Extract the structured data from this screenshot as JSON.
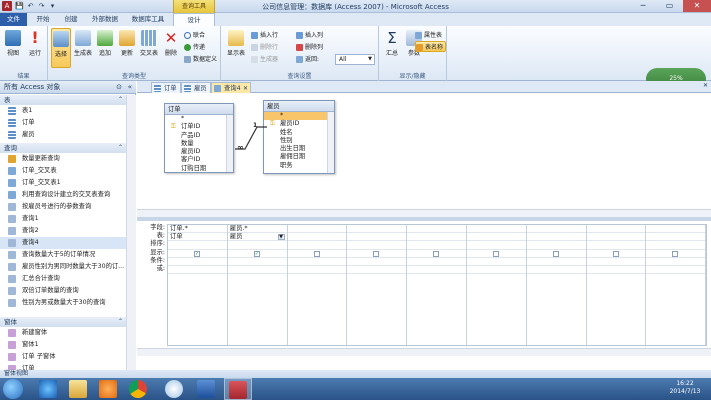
{
  "window": {
    "title": "公司信息管理：数据库 (Access 2007) - Microsoft Access",
    "context_tab": "查询工具",
    "close_glyph": "✕",
    "min_glyph": "─",
    "max_glyph": "▭"
  },
  "app_icon": {
    "letter": "A"
  },
  "qat": [
    "💾",
    "↶",
    "↷",
    "▾"
  ],
  "ribbon_tabs": [
    "文件",
    "开始",
    "创建",
    "外部数据",
    "数据库工具",
    "设计"
  ],
  "ribbon": {
    "groups": [
      "结果",
      "查询类型",
      "查询设置",
      "显示/隐藏"
    ],
    "buttons": {
      "view": "视图",
      "run": "运行",
      "select": "选择",
      "make_table": "生成表",
      "append": "追加",
      "update": "更新",
      "crosstab": "交叉表",
      "delete": "删除",
      "union": "联合",
      "pass_through": "传递",
      "data_definition": "数据定义",
      "show_table": "显示表",
      "insert_rows": "插入行",
      "delete_rows": "删除行",
      "builder": "生成器",
      "insert_columns": "插入列",
      "delete_columns": "删除列",
      "return_label": "返回:",
      "return_value": "All",
      "totals": "汇总",
      "parameters": "参数",
      "property_sheet": "属性表",
      "table_names": "表名称"
    },
    "widget_text": "25%"
  },
  "nav": {
    "header": "所有 Access 对象",
    "sections": [
      {
        "title": "表",
        "items": [
          "表1",
          "订单",
          "雇员"
        ]
      },
      {
        "title": "查询",
        "items": [
          "数量更新查询",
          "订单_交叉表",
          "订单_交叉表1",
          "利用查询设计建立的交叉表查询",
          "按雇员号进行的参数查询",
          "查询1",
          "查询2",
          "查询4",
          "查询数量大于5的订单情况",
          "雇员性别为男同时数量大于30的订...",
          "汇总合计查询",
          "双倍订单数量的查询",
          "性别为男或数量大于30的查询"
        ]
      },
      {
        "title": "窗体",
        "items": [
          "新建窗体",
          "窗体1",
          "订单 子窗体",
          "订单"
        ]
      }
    ]
  },
  "doc_tabs": [
    "订单",
    "雇员",
    "查询4"
  ],
  "tables": [
    {
      "name": "订单",
      "fields": [
        "*",
        "订单ID",
        "产品ID",
        "数量",
        "雇员ID",
        "客户ID",
        "订购日期"
      ]
    },
    {
      "name": "雇员",
      "fields": [
        "*",
        "雇员ID",
        "姓名",
        "性别",
        "出生日期",
        "雇佣日期",
        "职务"
      ]
    }
  ],
  "relationship": {
    "one": "1",
    "many": "∞"
  },
  "grid": {
    "row_labels": [
      "字段:",
      "表:",
      "排序:",
      "显示:",
      "条件:",
      "或:"
    ],
    "columns": [
      {
        "field": "订单.*",
        "table": "订单",
        "show": true
      },
      {
        "field": "雇员.*",
        "table": "雇员",
        "show": true
      },
      {
        "field": "",
        "table": "",
        "show": false
      },
      {
        "field": "",
        "table": "",
        "show": false
      },
      {
        "field": "",
        "table": "",
        "show": false
      },
      {
        "field": "",
        "table": "",
        "show": false
      },
      {
        "field": "",
        "table": "",
        "show": false
      },
      {
        "field": "",
        "table": "",
        "show": false
      },
      {
        "field": "",
        "table": "",
        "show": false
      }
    ]
  },
  "status": {
    "text": "窗体视图"
  },
  "taskbar": {
    "time": "16:22",
    "date": "2014/7/13"
  },
  "colors": {
    "file_tab": "#2c5eaa",
    "context_tab": "#e8c53a",
    "access_red": "#a4262c",
    "selection": "#f9c56a"
  }
}
